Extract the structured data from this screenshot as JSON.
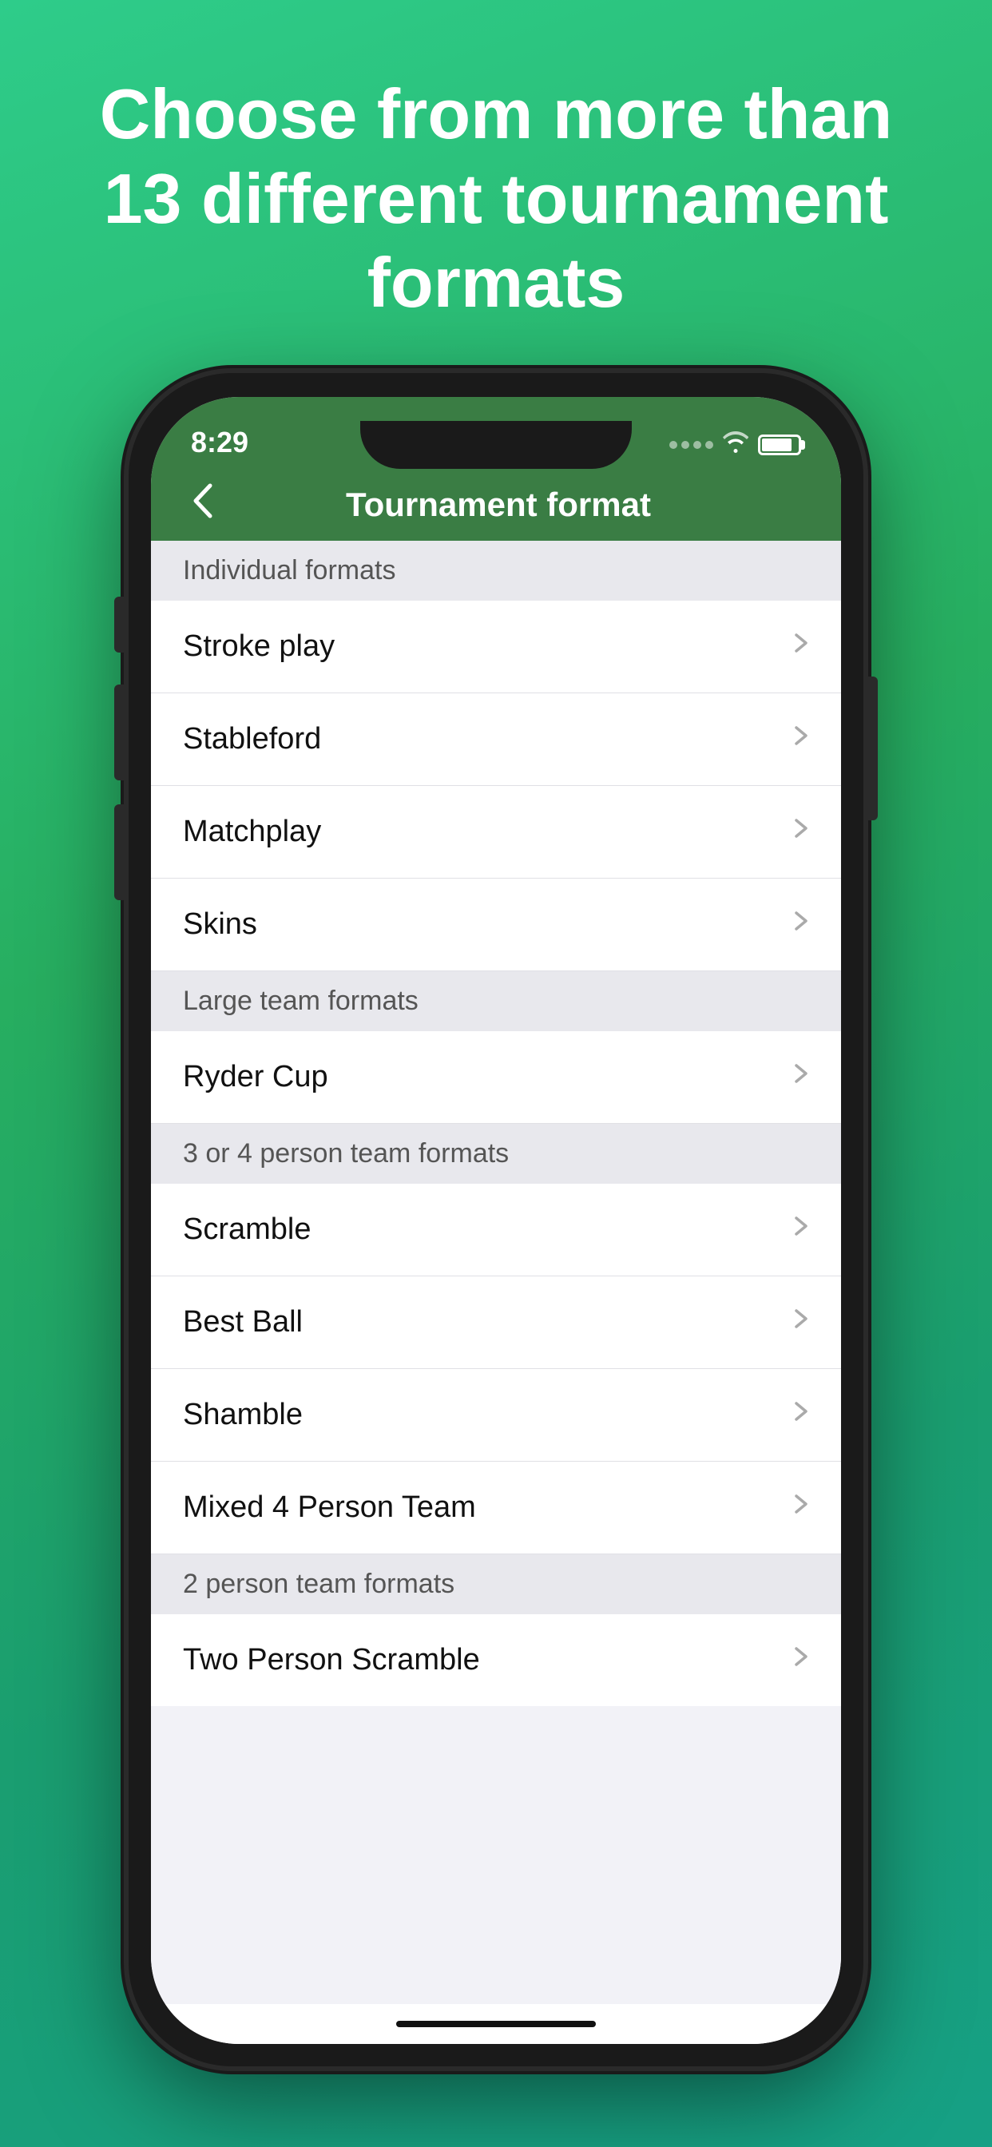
{
  "hero": {
    "title": "Choose from more than 13 different tournament formats"
  },
  "status_bar": {
    "time": "8:29"
  },
  "nav": {
    "title": "Tournament format",
    "back_label": "‹"
  },
  "sections": [
    {
      "id": "individual",
      "header": "Individual formats",
      "items": [
        {
          "label": "Stroke play"
        },
        {
          "label": "Stableford"
        },
        {
          "label": "Matchplay"
        },
        {
          "label": "Skins"
        }
      ]
    },
    {
      "id": "large-team",
      "header": "Large team formats",
      "items": [
        {
          "label": "Ryder Cup"
        }
      ]
    },
    {
      "id": "3-4-person",
      "header": "3 or 4 person team formats",
      "items": [
        {
          "label": "Scramble"
        },
        {
          "label": "Best Ball"
        },
        {
          "label": "Shamble"
        },
        {
          "label": "Mixed 4 Person Team"
        }
      ]
    },
    {
      "id": "2-person",
      "header": "2 person team formats",
      "items": [
        {
          "label": "Two Person Scramble"
        }
      ]
    }
  ],
  "icons": {
    "chevron": "›",
    "back": "‹",
    "wifi": "wifi",
    "battery": "battery"
  }
}
